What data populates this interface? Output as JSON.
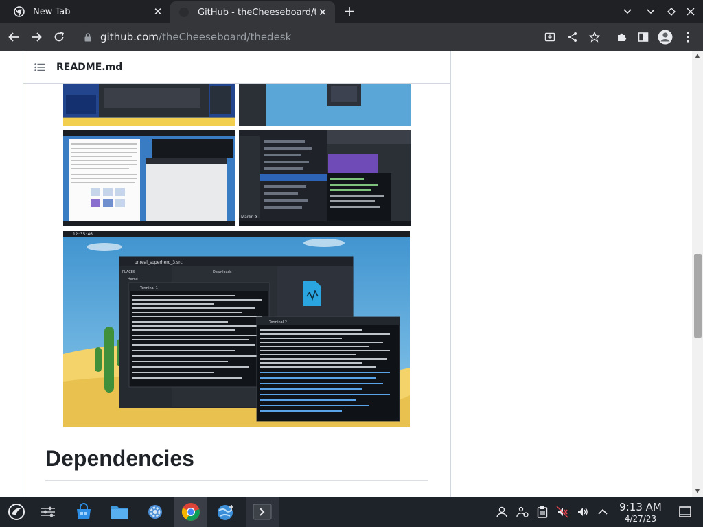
{
  "tabs": [
    {
      "title": "New Tab",
      "active": false
    },
    {
      "title": "GitHub - theCheeseboard/thedesk",
      "active": true
    }
  ],
  "omnibox": {
    "host": "github.com",
    "path": "/theCheeseboard/thedesk"
  },
  "readme": {
    "file_name": "README.md",
    "section_heading": "Dependencies"
  },
  "screenshot_texts": {
    "terminal1_title": "Terminal 1",
    "terminal2_title": "Terminal 2",
    "filemanager_title": "unreal_superhero_3.src",
    "places_label": "PLACES",
    "home_label": "Home",
    "downloads_label": "Downloads",
    "topbar_time": "12:35:46",
    "marlin_label": "Marlin X"
  },
  "taskbar": {
    "time": "9:13 AM",
    "date": "4/27/23"
  },
  "colors": {
    "chrome_dark": "#202124",
    "toolbar": "#35363a",
    "taskbar": "#1e2229",
    "desktop_blue": "#5aa6d6",
    "desktop_sand": "#f3d36a"
  }
}
